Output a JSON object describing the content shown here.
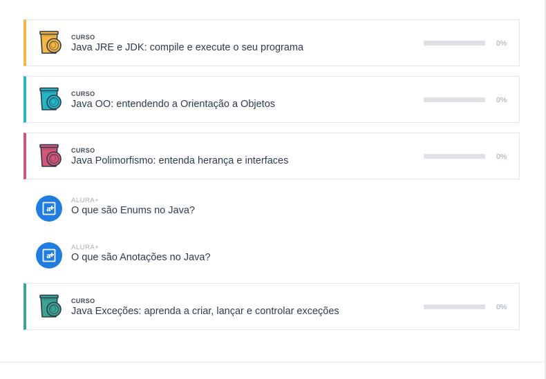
{
  "courses": [
    {
      "type": "CURSO",
      "title": "Java JRE e JDK: compile e execute o seu programa",
      "progress": 0,
      "percent_label": "0%",
      "icon": "java-cup-icon",
      "accent": "#f5b742",
      "icon_color": "#f5b742"
    },
    {
      "type": "CURSO",
      "title": "Java OO: entendendo a Orientação a Objetos",
      "progress": 0,
      "percent_label": "0%",
      "icon": "java-cup-icon",
      "accent": "#21b6c8",
      "icon_color": "#21b6c8"
    },
    {
      "type": "CURSO",
      "title": "Java Polimorfismo: entenda herança e interfaces",
      "progress": 0,
      "percent_label": "0%",
      "icon": "java-cup-icon",
      "accent": "#d55577",
      "icon_color": "#d55577"
    },
    {
      "type": "CURSO",
      "title": "Java Exceções: aprenda a criar, lançar e controlar exceções",
      "progress": 0,
      "percent_label": "0%",
      "icon": "java-cup-icon",
      "accent": "#3aa394",
      "icon_color": "#3aa394"
    }
  ],
  "articles": [
    {
      "type": "ALURA+",
      "title": "O que são Enums no Java?",
      "icon": "alura-plus-icon",
      "color": "#1f7ce0"
    },
    {
      "type": "ALURA+",
      "title": "O que são Anotações no Java?",
      "icon": "alura-plus-icon",
      "color": "#1f7ce0"
    }
  ]
}
